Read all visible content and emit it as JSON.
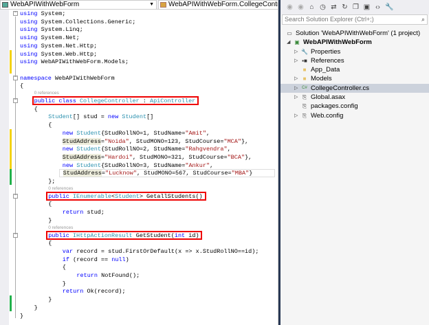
{
  "navbar": {
    "project_combo": "WebAPIWithWebForm",
    "class_combo": "WebAPIWithWebForm.CollegeController"
  },
  "code": [
    {
      "kind": "code",
      "indent": 0,
      "tokens": [
        [
          "k",
          "using"
        ],
        [
          "p",
          " System;"
        ]
      ]
    },
    {
      "kind": "code",
      "indent": 0,
      "tokens": [
        [
          "k",
          "using"
        ],
        [
          "p",
          " System.Collections.Generic;"
        ]
      ]
    },
    {
      "kind": "code",
      "indent": 0,
      "tokens": [
        [
          "k",
          "using"
        ],
        [
          "p",
          " System.Linq;"
        ]
      ]
    },
    {
      "kind": "code",
      "indent": 0,
      "tokens": [
        [
          "k",
          "using"
        ],
        [
          "p",
          " System.Net;"
        ]
      ]
    },
    {
      "kind": "code",
      "indent": 0,
      "tokens": [
        [
          "k",
          "using"
        ],
        [
          "p",
          " System.Net.Http;"
        ]
      ]
    },
    {
      "kind": "code",
      "indent": 0,
      "tokens": [
        [
          "k",
          "using"
        ],
        [
          "p",
          " System.Web.Http;"
        ]
      ]
    },
    {
      "kind": "code",
      "indent": 0,
      "tokens": [
        [
          "k",
          "using"
        ],
        [
          "p",
          " WebAPIWithWebForm.Models;"
        ]
      ]
    },
    {
      "kind": "code",
      "indent": 0,
      "tokens": []
    },
    {
      "kind": "code",
      "indent": 0,
      "tokens": [
        [
          "k",
          "namespace"
        ],
        [
          "p",
          " WebAPIWithWebForm"
        ]
      ]
    },
    {
      "kind": "code",
      "indent": 0,
      "tokens": [
        [
          "p",
          "{"
        ]
      ]
    },
    {
      "kind": "lens",
      "indent": 1,
      "text": "0 references"
    },
    {
      "kind": "code",
      "indent": 1,
      "box": true,
      "tokens": [
        [
          "k",
          "public"
        ],
        [
          "p",
          " "
        ],
        [
          "k",
          "class"
        ],
        [
          "p",
          " "
        ],
        [
          "t",
          "CollegeController"
        ],
        [
          "p",
          " : "
        ],
        [
          "t",
          "ApiController"
        ]
      ]
    },
    {
      "kind": "code",
      "indent": 1,
      "tokens": [
        [
          "p",
          "{"
        ]
      ]
    },
    {
      "kind": "code",
      "indent": 2,
      "tokens": [
        [
          "t",
          "Student"
        ],
        [
          "p",
          "[] stud = "
        ],
        [
          "k",
          "new"
        ],
        [
          "p",
          " "
        ],
        [
          "t",
          "Student"
        ],
        [
          "p",
          "[]"
        ]
      ]
    },
    {
      "kind": "code",
      "indent": 2,
      "tokens": [
        [
          "p",
          "{"
        ]
      ]
    },
    {
      "kind": "code",
      "indent": 3,
      "tokens": [
        [
          "k",
          "new"
        ],
        [
          "p",
          " "
        ],
        [
          "t",
          "Student"
        ],
        [
          "p",
          "{StudRollNO=1, StudName="
        ],
        [
          "s",
          "\"Amit\""
        ],
        [
          "p",
          ","
        ]
      ]
    },
    {
      "kind": "code",
      "indent": 3,
      "tokens": [
        [
          "hl",
          "StudAddress"
        ],
        [
          "p",
          "="
        ],
        [
          "s",
          "\"Noida\""
        ],
        [
          "p",
          ", StudMONO=123, StudCourse="
        ],
        [
          "s",
          "\"MCA\""
        ],
        [
          "p",
          "},"
        ]
      ]
    },
    {
      "kind": "code",
      "indent": 3,
      "tokens": [
        [
          "k",
          "new"
        ],
        [
          "p",
          " "
        ],
        [
          "t",
          "Student"
        ],
        [
          "p",
          "{StudRollNO=2, StudName="
        ],
        [
          "s",
          "\"Rahgvendra\""
        ],
        [
          "p",
          ","
        ]
      ]
    },
    {
      "kind": "code",
      "indent": 3,
      "tokens": [
        [
          "hl",
          "StudAddress"
        ],
        [
          "p",
          "="
        ],
        [
          "s",
          "\"Hardoi\""
        ],
        [
          "p",
          ", StudMONO=321, StudCourse="
        ],
        [
          "s",
          "\"BCA\""
        ],
        [
          "p",
          "},"
        ]
      ]
    },
    {
      "kind": "code",
      "indent": 3,
      "tokens": [
        [
          "k",
          "new"
        ],
        [
          "p",
          " "
        ],
        [
          "t",
          "Student"
        ],
        [
          "p",
          "{StudRollNO=3, StudName="
        ],
        [
          "s",
          "\"Ankur\""
        ],
        [
          "p",
          ","
        ]
      ]
    },
    {
      "kind": "code",
      "indent": 3,
      "current": true,
      "tokens": [
        [
          "hl",
          "StudAddress"
        ],
        [
          "p",
          "="
        ],
        [
          "s",
          "\"Lucknow\""
        ],
        [
          "p",
          ", StudMONO=567, StudCourse="
        ],
        [
          "s",
          "\"MBA\""
        ],
        [
          "p",
          "}"
        ]
      ]
    },
    {
      "kind": "code",
      "indent": 2,
      "tokens": [
        [
          "p",
          "};"
        ]
      ]
    },
    {
      "kind": "lens",
      "indent": 2,
      "text": "0 references"
    },
    {
      "kind": "code",
      "indent": 2,
      "box": true,
      "tokens": [
        [
          "k",
          "public"
        ],
        [
          "p",
          " "
        ],
        [
          "t",
          "IEnumerable"
        ],
        [
          "p",
          "<"
        ],
        [
          "t",
          "Student"
        ],
        [
          "p",
          "> GetallStudents()"
        ]
      ]
    },
    {
      "kind": "code",
      "indent": 2,
      "tokens": [
        [
          "p",
          "{"
        ]
      ]
    },
    {
      "kind": "code",
      "indent": 3,
      "tokens": [
        [
          "k",
          "return"
        ],
        [
          "p",
          " stud;"
        ]
      ]
    },
    {
      "kind": "code",
      "indent": 2,
      "tokens": [
        [
          "p",
          "}"
        ]
      ]
    },
    {
      "kind": "lens",
      "indent": 2,
      "text": "0 references"
    },
    {
      "kind": "code",
      "indent": 2,
      "box": true,
      "tokens": [
        [
          "k",
          "public"
        ],
        [
          "p",
          " "
        ],
        [
          "t",
          "IHttpActionResult"
        ],
        [
          "p",
          " GetStudent("
        ],
        [
          "k",
          "int"
        ],
        [
          "p",
          " id)"
        ]
      ]
    },
    {
      "kind": "code",
      "indent": 2,
      "tokens": [
        [
          "p",
          "{"
        ]
      ]
    },
    {
      "kind": "code",
      "indent": 3,
      "tokens": [
        [
          "k",
          "var"
        ],
        [
          "p",
          " record = stud.FirstOrDefault(x => x.StudRollNO==id);"
        ]
      ]
    },
    {
      "kind": "code",
      "indent": 3,
      "tokens": [
        [
          "k",
          "if"
        ],
        [
          "p",
          " (record == "
        ],
        [
          "k",
          "null"
        ],
        [
          "p",
          ")"
        ]
      ]
    },
    {
      "kind": "code",
      "indent": 3,
      "tokens": [
        [
          "p",
          "{"
        ]
      ]
    },
    {
      "kind": "code",
      "indent": 4,
      "tokens": [
        [
          "k",
          "return"
        ],
        [
          "p",
          " NotFound();"
        ]
      ]
    },
    {
      "kind": "code",
      "indent": 3,
      "tokens": [
        [
          "p",
          "}"
        ]
      ]
    },
    {
      "kind": "code",
      "indent": 3,
      "tokens": [
        [
          "k",
          "return"
        ],
        [
          "p",
          " Ok(record);"
        ]
      ]
    },
    {
      "kind": "code",
      "indent": 2,
      "tokens": [
        [
          "p",
          "}"
        ]
      ]
    },
    {
      "kind": "code",
      "indent": 1,
      "tokens": [
        [
          "p",
          "}"
        ]
      ]
    },
    {
      "kind": "code",
      "indent": 0,
      "tokens": [
        [
          "p",
          "}"
        ]
      ]
    }
  ],
  "solution_explorer": {
    "search_placeholder": "Search Solution Explorer (Ctrl+;)",
    "items": [
      {
        "label": "Solution 'WebAPIWithWebForm' (1 project)",
        "level": 0,
        "icon": "solution-icon",
        "expander": ""
      },
      {
        "label": "WebAPIWithWebForm",
        "level": 0,
        "icon": "project-icon",
        "expander": "◢",
        "bold": true
      },
      {
        "label": "Properties",
        "level": 1,
        "icon": "wrench-icon",
        "expander": "▷"
      },
      {
        "label": "References",
        "level": 1,
        "icon": "references-icon",
        "expander": "▷"
      },
      {
        "label": "App_Data",
        "level": 1,
        "icon": "folder-icon",
        "expander": ""
      },
      {
        "label": "Models",
        "level": 1,
        "icon": "folder-icon",
        "expander": "▷"
      },
      {
        "label": "CollegeController.cs",
        "level": 1,
        "icon": "csharp-file-icon",
        "expander": "▷",
        "selected": true
      },
      {
        "label": "Global.asax",
        "level": 1,
        "icon": "asax-file-icon",
        "expander": "▷"
      },
      {
        "label": "packages.config",
        "level": 1,
        "icon": "config-file-icon",
        "expander": ""
      },
      {
        "label": "Web.config",
        "level": 1,
        "icon": "config-file-icon",
        "expander": "▷"
      }
    ]
  },
  "colors": {
    "keyword": "#0000ff",
    "type": "#2b91af",
    "string": "#a31515",
    "highlight_box": "#e00000",
    "changed_bar": "#f4d20f",
    "saved_bar": "#21b14b"
  }
}
